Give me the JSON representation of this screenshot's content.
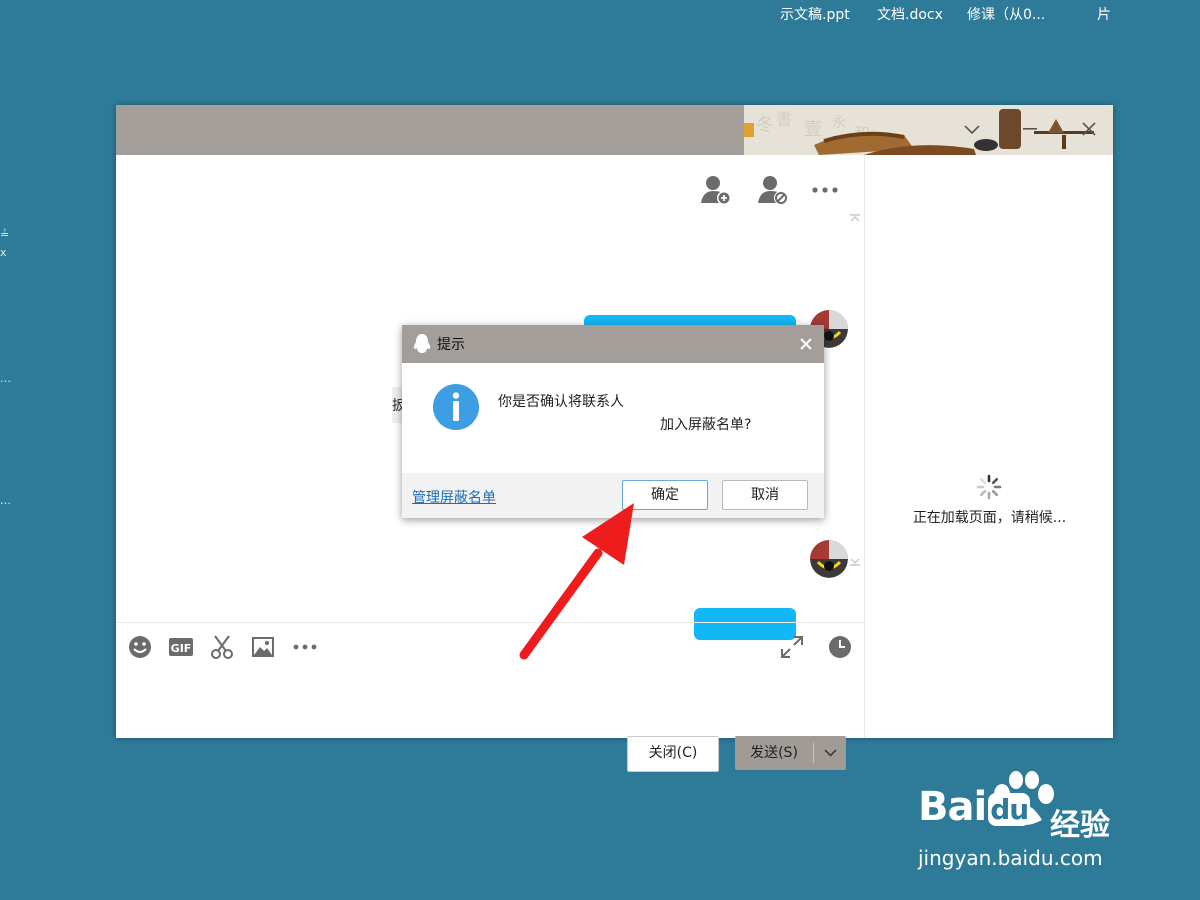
{
  "desktop": {
    "files": [
      "示文稿.ppt",
      "文档.docx",
      "修课（从0...",
      "片"
    ],
    "edge_fragments": [
      "≟",
      "x",
      "…",
      "…"
    ]
  },
  "chat_window": {
    "partial_message_char": "扳"
  },
  "chat_input": {
    "close_label": "关闭(C)",
    "send_label": "发送(S)"
  },
  "side_panel": {
    "loading_text": "正在加载页面，请稍候..."
  },
  "dialog": {
    "title": "提示",
    "line1": "你是否确认将联系人",
    "line2": "加入屏蔽名单?",
    "manage_link": "管理屏蔽名单",
    "ok_label": "确定",
    "cancel_label": "取消"
  },
  "colors": {
    "desktop_bg": "#2e7b99",
    "title_bar": "#a39e99",
    "bubble_blue": "#12b7f5",
    "arrow_red": "#ee1c1c",
    "link_blue": "#1a6fb8"
  },
  "watermark": {
    "bai": "Bai",
    "du": "du",
    "jingyan": "经验",
    "url": "jingyan.baidu.com"
  }
}
